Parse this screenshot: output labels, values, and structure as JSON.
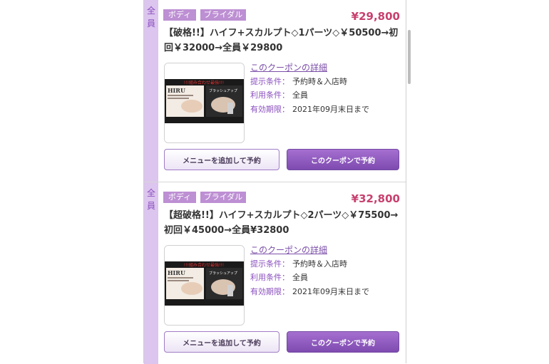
{
  "coupons": [
    {
      "side_label": [
        "全",
        "員"
      ],
      "tags": [
        "ボディ",
        "ブライダル"
      ],
      "price": "¥29,800",
      "title": "【破格!!】ハイフ+スカルプト◇1パーツ◇￥50500→初回￥32000→全員￥29800",
      "detail_link": "このクーポンの詳細",
      "conditions": [
        {
          "key": "提示条件：",
          "value": "予約時＆入店時"
        },
        {
          "key": "利用条件：",
          "value": "全員"
        },
        {
          "key": "有効期限：",
          "value": "2021年09月末日まで"
        }
      ],
      "image": {
        "brand": "HIRU",
        "banner": "!!!組み合わせ最強!!!",
        "right_caption": "ブラッシュアップ"
      },
      "add_menu_label": "メニューを追加して予約",
      "reserve_label": "このクーポンで予約"
    },
    {
      "side_label": [
        "全",
        "員"
      ],
      "tags": [
        "ボディ",
        "ブライダル"
      ],
      "price": "¥32,800",
      "title": "【超破格!!】ハイフ+スカルプト◇2パーツ◇￥75500→初回￥45000→全員¥32800",
      "detail_link": "このクーポンの詳細",
      "conditions": [
        {
          "key": "提示条件：",
          "value": "予約時＆入店時"
        },
        {
          "key": "利用条件：",
          "value": "全員"
        },
        {
          "key": "有効期限：",
          "value": "2021年09月末日まで"
        }
      ],
      "image": {
        "brand": "HIRU",
        "banner": "!!!組み合わせ最強!!!",
        "right_caption": "ブラッシュアップ"
      },
      "add_menu_label": "メニューを追加して予約",
      "reserve_label": "このクーポンで予約"
    }
  ]
}
